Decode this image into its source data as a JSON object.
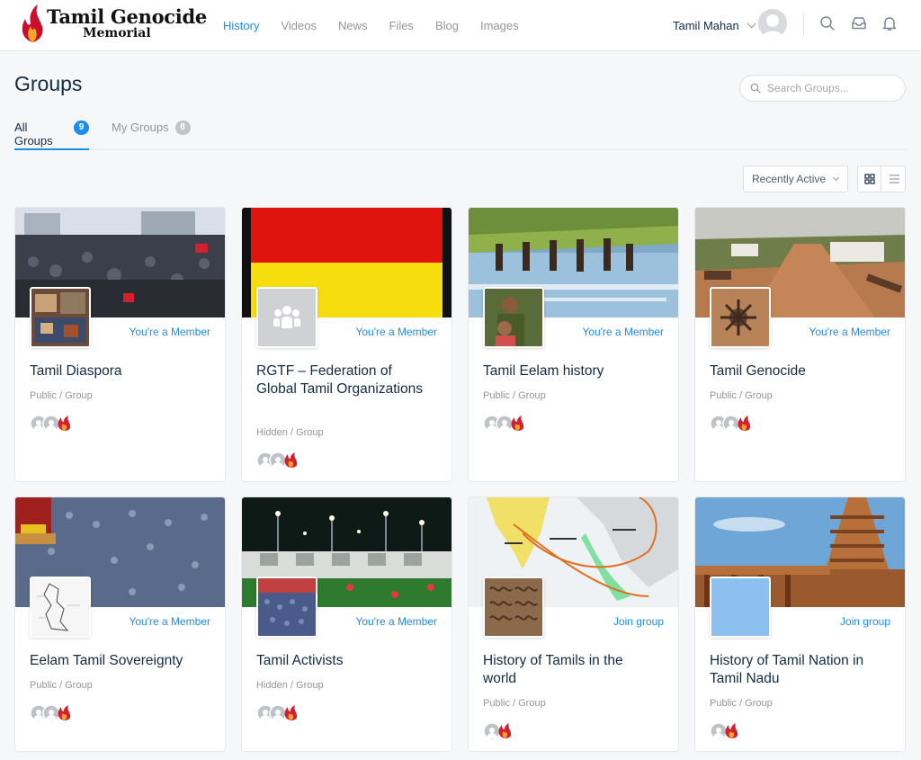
{
  "site": {
    "logo_title": "Tamil Genocide",
    "logo_subtitle": "Memorial"
  },
  "nav": {
    "items": [
      {
        "label": "History",
        "active": true
      },
      {
        "label": "Videos",
        "active": false
      },
      {
        "label": "News",
        "active": false
      },
      {
        "label": "Files",
        "active": false
      },
      {
        "label": "Blog",
        "active": false
      },
      {
        "label": "Images",
        "active": false
      }
    ]
  },
  "user": {
    "name": "Tamil Mahan"
  },
  "header_icons": [
    "search-icon",
    "inbox-icon",
    "bell-icon"
  ],
  "page": {
    "title": "Groups"
  },
  "search": {
    "placeholder": "Search Groups..."
  },
  "tabs": [
    {
      "label": "All Groups",
      "count": "9",
      "active": true
    },
    {
      "label": "My Groups",
      "count": "8",
      "active": false
    }
  ],
  "sort": {
    "selected": "Recently Active"
  },
  "view_toggle": [
    "grid-view-icon",
    "list-view-icon"
  ],
  "colors": {
    "accent": "#1e8de8",
    "text": "#122b46",
    "muted": "#939597"
  },
  "groups": [
    {
      "name": "Tamil Diaspora",
      "type": "Public / Group",
      "status": "You're a Member"
    },
    {
      "name": "RGTF – Federation of Global Tamil Organizations",
      "type": "Hidden / Group",
      "status": "You're a Member"
    },
    {
      "name": "Tamil Eelam history",
      "type": "Public / Group",
      "status": "You're a Member"
    },
    {
      "name": "Tamil Genocide",
      "type": "Public / Group",
      "status": "You're a Member"
    },
    {
      "name": "Eelam Tamil Sovereignty",
      "type": "Public / Group",
      "status": "You're a Member"
    },
    {
      "name": "Tamil Activists",
      "type": "Hidden / Group",
      "status": "You're a Member"
    },
    {
      "name": "History of Tamils in the world",
      "type": "Public / Group",
      "status": "Join group"
    },
    {
      "name": "History of Tamil Nation in Tamil Nadu",
      "type": "Public / Group",
      "status": "Join group"
    }
  ]
}
